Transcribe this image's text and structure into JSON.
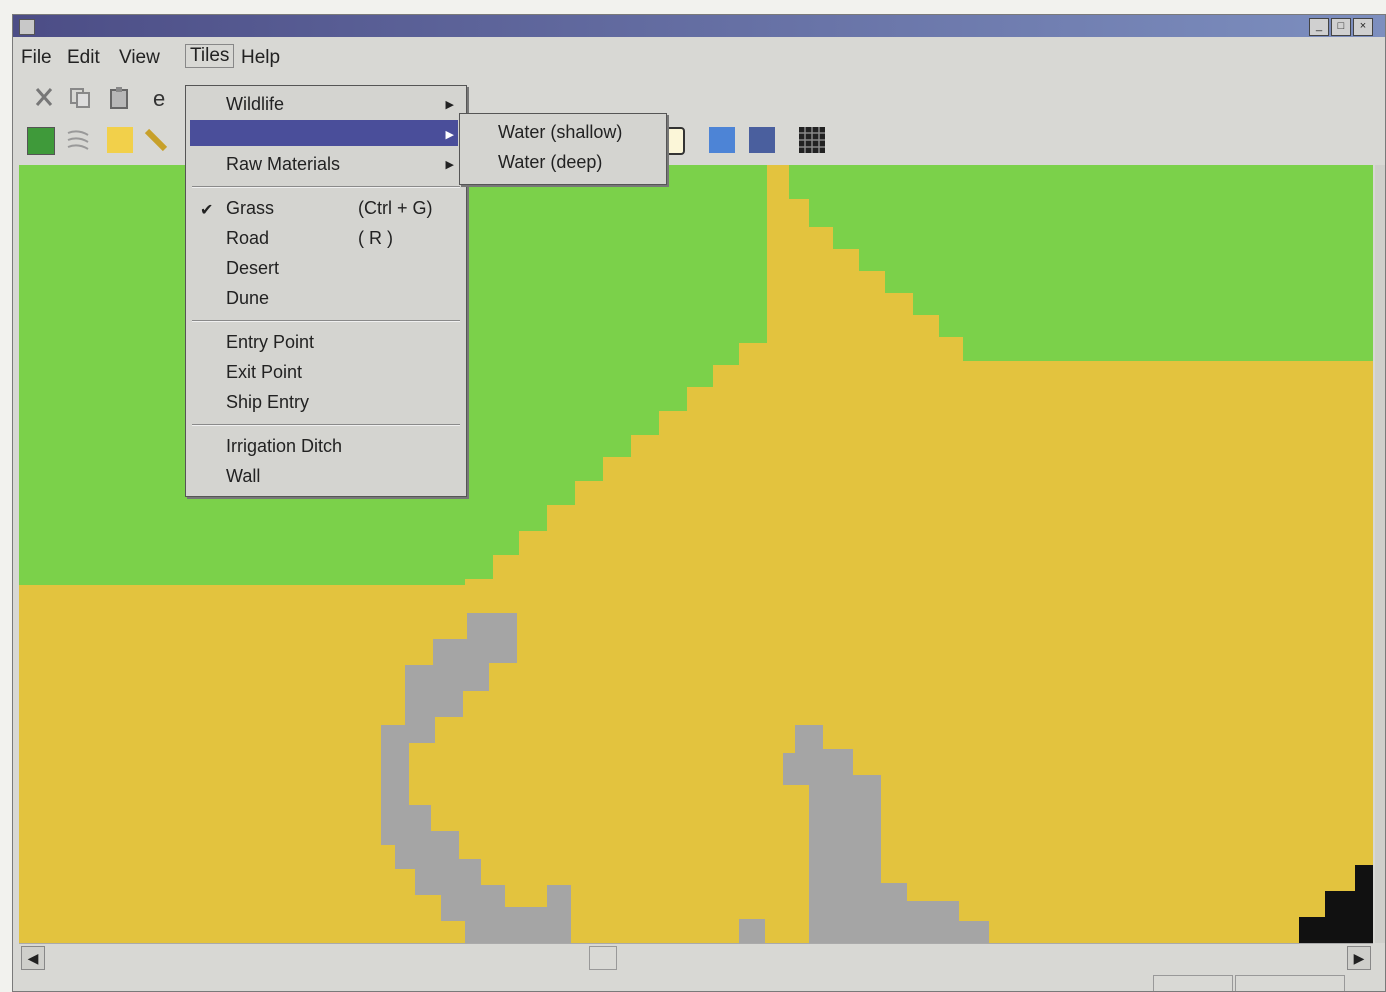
{
  "menubar": {
    "file": "File",
    "edit": "Edit",
    "view": "View",
    "tiles": "Tiles",
    "help": "Help"
  },
  "tiles_menu": {
    "wildlife": "Wildlife",
    "raw_materials": "Raw Materials",
    "grass": "Grass",
    "grass_shortcut": "(Ctrl + G)",
    "road": "Road",
    "road_shortcut": "( R )",
    "desert": "Desert",
    "dune": "Dune",
    "entry_point": "Entry Point",
    "exit_point": "Exit Point",
    "ship_entry": "Ship Entry",
    "irrigation_ditch": "Irrigation Ditch",
    "wall": "Wall"
  },
  "water_submenu": {
    "shallow": "Water (shallow)",
    "deep": "Water (deep)"
  },
  "map_colors": {
    "grass": "#7bd14a",
    "desert": "#e3c33e",
    "rock": "#a5a5a5",
    "black": "#111111"
  }
}
